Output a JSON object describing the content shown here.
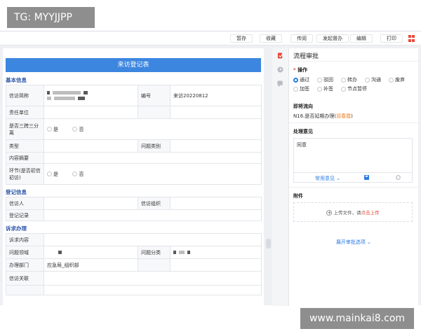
{
  "watermarks": {
    "top": "TG: MYYJJPP",
    "bottom": "www.mainkai8.com"
  },
  "toolbar": {
    "buttons": [
      "暂存",
      "收藏",
      "传阅",
      "发起督办",
      "编辑",
      "打印"
    ]
  },
  "form": {
    "title": "来访登记表",
    "sections": {
      "basic": "基本信息",
      "register": "登记信息",
      "appeal": "诉求办理"
    },
    "basic_rows": {
      "visitor_summary_label": "信访简称",
      "number_label": "编号",
      "number_value": "来访20220812",
      "responsible_unit_label": "责任单位",
      "three_cross_label": "是否三跨三分离",
      "yes": "是",
      "no": "否",
      "type_label": "类型",
      "issue_category_label": "问题类别",
      "content_summary_label": "内容摘要",
      "first_visit_label": "环节(是否初信初访)"
    },
    "register_rows": {
      "visitor_label": "信访人",
      "org_label": "信访组织",
      "record_label": "登记记录"
    },
    "appeal_rows": {
      "content_label": "诉求内容",
      "domain_label": "问题领域",
      "classification_label": "问题分类",
      "dept_label": "办理部门",
      "dept_value": "应急局_组织部",
      "relation_label": "信访关联"
    }
  },
  "review": {
    "title": "流程审批",
    "operation_label": "操作",
    "options_row1": [
      "通过",
      "驳回",
      "转办",
      "沟通",
      "废弃"
    ],
    "options_row2": [
      "加签",
      "补签",
      "节点暂停"
    ],
    "selected_option": "通过",
    "next_flow_label": "即将流向",
    "next_flow_text": "N16.是否延期办理(",
    "next_flow_person": "邱春霞",
    "next_flow_close": ")",
    "opinion_label": "处理意见",
    "opinion_value": "同意",
    "common_opinion": "常用意见",
    "attachment_label": "附件",
    "upload_text": "上传文件，请",
    "upload_link": "点击上传",
    "expand_text": "展开审批选项"
  },
  "colors": {
    "accent": "#3c86e0",
    "section": "#2c54a8",
    "required": "#e64a3b",
    "link": "#2d7ce0",
    "highlight": "#e8822a"
  }
}
